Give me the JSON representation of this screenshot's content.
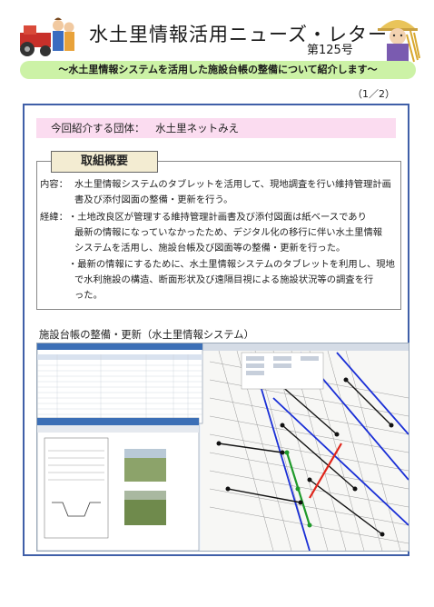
{
  "header": {
    "title": "水土里情報活用ニューズ・レター",
    "issue": "第125号"
  },
  "headline": "～水土里情報システムを活用した施設台帳の整備について紹介します～",
  "page_indicator": "（1／2）",
  "organization": {
    "label": "今回紹介する団体：",
    "name": "水土里ネットみえ"
  },
  "summary": {
    "heading": "取組概要",
    "content_label": "内容：",
    "content_lines": [
      "水土里情報システムのタブレットを活用して、現地調査を行い維持管理計画",
      "書及び添付図面の整備・更新を行う。"
    ],
    "background_label": "経緯：",
    "background_lines": [
      "・土地改良区が管理する維持管理計画書及び添付図面は紙ベースであり",
      "最新の情報になっていなかったため、デジタル化の移行に伴い水土里情報",
      "システムを活用し、施設台帳及び図面等の整備・更新を行った。",
      "・最新の情報にするために、水土里情報システムのタブレットを利用し、現地",
      "で水利施設の構造、断面形状及び遠隔目視による施設状況等の調査を行",
      "った。"
    ]
  },
  "figure": {
    "caption": "施設台帳の整備・更新（水土里情報システム）"
  },
  "colors": {
    "headline_band": "#ccf2a6",
    "org_band": "#fbdcf0",
    "frame": "#3f5fa8",
    "heading_fill": "#f3ecd2"
  }
}
